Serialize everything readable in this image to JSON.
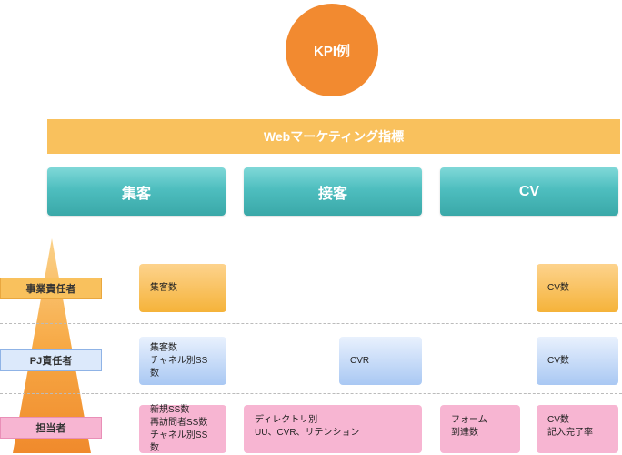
{
  "title": "KPI例",
  "banner": "Webマーケティング指標",
  "categories": [
    "集客",
    "接客",
    "CV"
  ],
  "roles": [
    "事業責任者",
    "PJ責任者",
    "担当者"
  ],
  "metrics": {
    "exec_acquisition": [
      "集客数"
    ],
    "exec_cv": [
      "CV数"
    ],
    "pj_acquisition": [
      "集客数",
      "チャネル別SS数"
    ],
    "pj_service": [
      "CVR"
    ],
    "pj_cv": [
      "CV数"
    ],
    "staff_acquisition": [
      "新規SS数",
      "再訪問者SS数",
      "チャネル別SS数"
    ],
    "staff_service": [
      "ディレクトリ別",
      "UU、CVR、リテンション"
    ],
    "staff_form": [
      "フォーム",
      "到達数"
    ],
    "staff_cv": [
      "CV数",
      "記入完了率"
    ]
  },
  "colors": {
    "circle": "#f28a30",
    "banner": "#f9c15d",
    "category": "#4ebebf",
    "exec": "#f5b33a",
    "pj": "#a9c8f3",
    "staff": "#f7b5d2"
  }
}
